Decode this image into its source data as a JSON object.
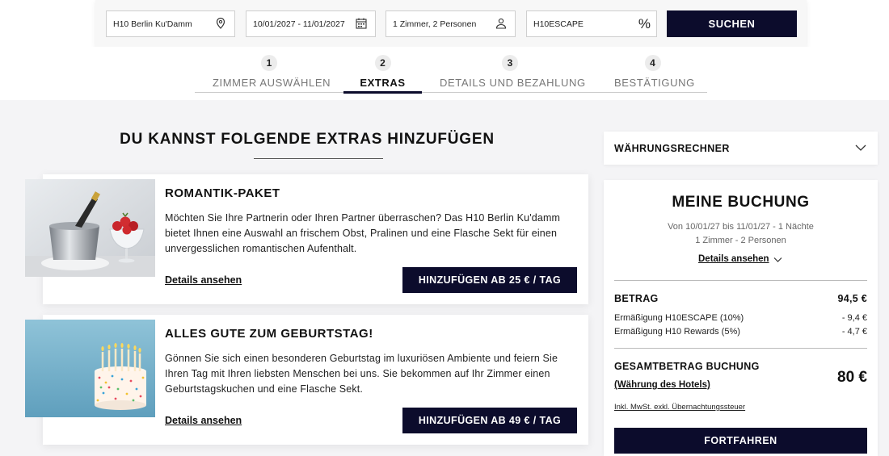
{
  "search": {
    "hotel": "H10 Berlin Ku'Damm",
    "dates": "10/01/2027 - 11/01/2027",
    "rooms": "1 Zimmer, 2 Personen",
    "promo_code": "H10ESCAPE",
    "promo_icon": "%",
    "search_button": "SUCHEN"
  },
  "steps": [
    {
      "num": "1",
      "label": "ZIMMER AUSWÄHLEN",
      "active": false
    },
    {
      "num": "2",
      "label": "EXTRAS",
      "active": true
    },
    {
      "num": "3",
      "label": "DETAILS UND BEZAHLUNG",
      "active": false
    },
    {
      "num": "4",
      "label": "BESTÄTIGUNG",
      "active": false
    }
  ],
  "main": {
    "title": "DU KANNST FOLGENDE EXTRAS HINZUFÜGEN",
    "extras": [
      {
        "title": "ROMANTIK-PAKET",
        "description": "Möchten Sie Ihre Partnerin oder Ihren Partner überraschen? Das H10 Berlin Ku'damm bietet Ihnen eine Auswahl an frischem Obst, Pralinen und eine Flasche Sekt für einen unvergesslichen romantischen Aufenthalt.",
        "link": "Details ansehen",
        "button": "HINZUFÜGEN AB 25 € / TAG",
        "image": "champagne-strawberries-image"
      },
      {
        "title": "ALLES GUTE ZUM GEBURTSTAG!",
        "description": "Gönnen Sie sich einen besonderen Geburtstag im luxuriösen Ambiente und feiern Sie Ihren Tag mit Ihren liebsten Menschen bei uns. Sie bekommen auf Ihr Zimmer einen Geburtstagskuchen und eine Flasche Sekt.",
        "link": "Details ansehen",
        "button": "HINZUFÜGEN AB 49 € / TAG",
        "image": "birthday-cake-image"
      }
    ]
  },
  "sidebar": {
    "currency_label": "WÄHRUNGSRECHNER",
    "booking": {
      "title": "MEINE BUCHUNG",
      "dates_line": "Von 10/01/27 bis 11/01/27 - 1 Nächte",
      "rooms_line": "1 Zimmer - 2 Personen",
      "details_link": "Details ansehen",
      "amount_label": "BETRAG",
      "amount_value": "94,5 €",
      "discount1_label": "Ermäßigung H10ESCAPE (10%)",
      "discount1_value": "- 9,4 €",
      "discount2_label": "Ermäßigung H10 Rewards (5%)",
      "discount2_value": "- 4,7 €",
      "total_label": "GESAMTBETRAG BUCHUNG",
      "hotel_currency_link": "(Währung des Hotels)",
      "total_value": "80 €",
      "tax_note": "Inkl. MwSt. exkl. Übernachtungssteuer",
      "continue_button": "FORTFAHREN"
    }
  },
  "colors": {
    "primary": "#0c0c2c",
    "background": "#f4f4f6"
  }
}
